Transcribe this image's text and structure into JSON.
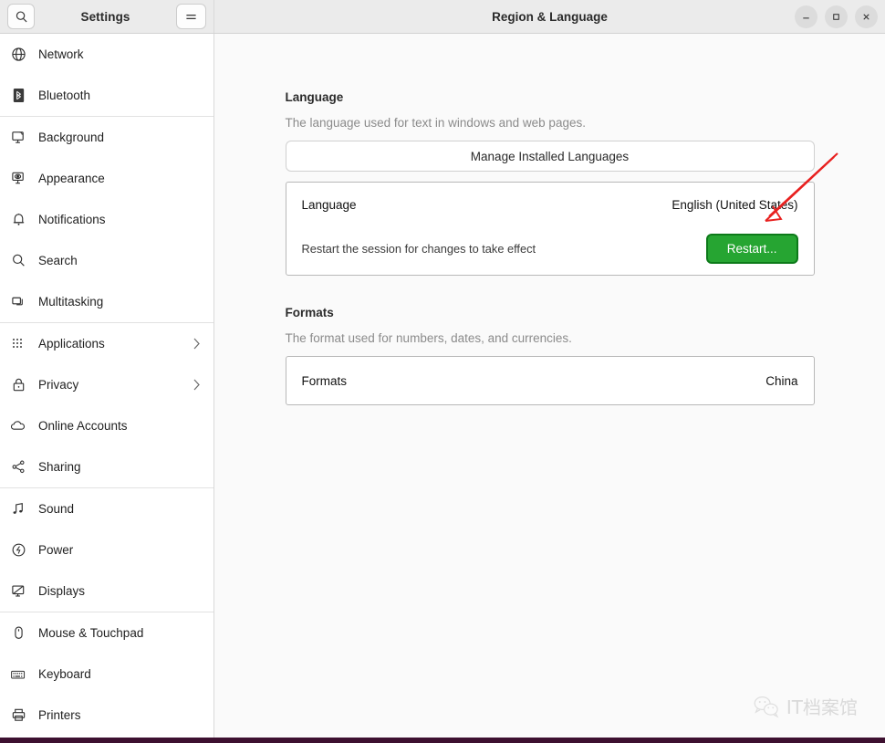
{
  "window": {
    "title": "Region & Language",
    "sidebar_title": "Settings",
    "controls": {
      "minimize": "minimize-button",
      "maximize": "maximize-button",
      "close": "close-button"
    },
    "search_icon": "search-icon",
    "menu_icon": "hamburger-menu-icon"
  },
  "sidebar": {
    "groups": [
      {
        "items": [
          {
            "label": "Network",
            "icon": "globe-icon"
          },
          {
            "label": "Bluetooth",
            "icon": "bluetooth-icon"
          }
        ]
      },
      {
        "items": [
          {
            "label": "Background",
            "icon": "monitor-background-icon"
          },
          {
            "label": "Appearance",
            "icon": "appearance-icon"
          },
          {
            "label": "Notifications",
            "icon": "bell-icon"
          },
          {
            "label": "Search",
            "icon": "search-icon"
          },
          {
            "label": "Multitasking",
            "icon": "windows-icon"
          }
        ]
      },
      {
        "items": [
          {
            "label": "Applications",
            "icon": "grid-dots-icon",
            "chevron": true
          },
          {
            "label": "Privacy",
            "icon": "lock-icon",
            "chevron": true
          },
          {
            "label": "Online Accounts",
            "icon": "cloud-icon"
          },
          {
            "label": "Sharing",
            "icon": "share-nodes-icon"
          }
        ]
      },
      {
        "items": [
          {
            "label": "Sound",
            "icon": "music-note-icon"
          },
          {
            "label": "Power",
            "icon": "power-icon"
          },
          {
            "label": "Displays",
            "icon": "displays-icon"
          }
        ]
      },
      {
        "items": [
          {
            "label": "Mouse & Touchpad",
            "icon": "mouse-icon"
          },
          {
            "label": "Keyboard",
            "icon": "keyboard-icon"
          },
          {
            "label": "Printers",
            "icon": "printer-icon"
          }
        ]
      }
    ]
  },
  "main": {
    "language_section": {
      "title": "Language",
      "description": "The language used for text in windows and web pages.",
      "manage_button": "Manage Installed Languages",
      "row_label": "Language",
      "row_value": "English (United States)",
      "restart_note": "Restart the session for changes to take effect",
      "restart_button": "Restart..."
    },
    "formats_section": {
      "title": "Formats",
      "description": "The format used for numbers, dates, and currencies.",
      "row_label": "Formats",
      "row_value": "China"
    }
  },
  "annotation": {
    "arrow_color": "#e8201f",
    "arrow_name": "red-pointer-arrow"
  },
  "watermark": {
    "text": "IT档案馆",
    "icon": "wechat-icon"
  },
  "colors": {
    "restart_green": "#26a532",
    "restart_border": "#0d7a1a",
    "desktop": "#3d1030"
  }
}
